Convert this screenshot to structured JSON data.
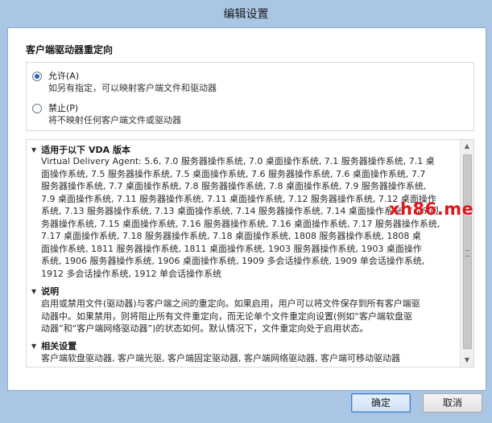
{
  "window": {
    "title": "编辑设置"
  },
  "section": {
    "title": "客户端驱动器重定向"
  },
  "options": [
    {
      "label": "允许(A)",
      "desc": "如另有指定，可以映射客户端文件和驱动器",
      "checked": true
    },
    {
      "label": "禁止(P)",
      "desc": "将不映射任何客户端文件或驱动器",
      "checked": false
    }
  ],
  "info": {
    "applies": {
      "title": "适用于以下 VDA 版本",
      "lines": [
        "Virtual Delivery Agent: 5.6, 7.0 服务器操作系统, 7.0 桌面操作系统, 7.1 服务器操作系统, 7.1 桌",
        "面操作系统, 7.5 服务器操作系统, 7.5 桌面操作系统, 7.6 服务器操作系统, 7.6 桌面操作系统, 7.7",
        "服务器操作系统, 7.7 桌面操作系统, 7.8 服务器操作系统, 7.8 桌面操作系统, 7.9 服务器操作系统,",
        "7.9 桌面操作系统, 7.11 服务器操作系统, 7.11 桌面操作系统, 7.12 服务器操作系统, 7.12 桌面操作",
        "系统, 7.13 服务器操作系统, 7.13 桌面操作系统, 7.14 服务器操作系统, 7.14 桌面操作系统, 7.15 服",
        "务器操作系统, 7.15 桌面操作系统, 7.16 服务器操作系统, 7.16 桌面操作系统, 7.17 服务器操作系统,",
        "7.17 桌面操作系统, 7.18 服务器操作系统, 7.18 桌面操作系统, 1808 服务器操作系统, 1808 桌",
        "面操作系统, 1811 服务器操作系统, 1811 桌面操作系统, 1903 服务器操作系统, 1903 桌面操作",
        "系统, 1906 服务器操作系统, 1906 桌面操作系统, 1909 多会话操作系统, 1909 单会话操作系统,",
        "1912 多会话操作系统, 1912 单会话操作系统"
      ]
    },
    "description": {
      "title": "说明",
      "lines": [
        "启用或禁用文件(驱动器)与客户端之间的重定向。如果启用，用户可以将文件保存到所有客户端驱",
        "动器中。如果禁用，则将阻止所有文件重定向，而无论单个文件重定向设置(例如“客户端软盘驱",
        "动器”和“客户端网络驱动器”)的状态如何。默认情况下，文件重定向处于启用状态。"
      ]
    },
    "related": {
      "title": "相关设置",
      "lines": [
        "客户端软盘驱动器, 客户端光驱, 客户端固定驱动器, 客户端网络驱动器, 客户端可移动驱动器"
      ]
    }
  },
  "buttons": {
    "ok": "确定",
    "cancel": "取消"
  },
  "watermark": "xh86.me"
}
